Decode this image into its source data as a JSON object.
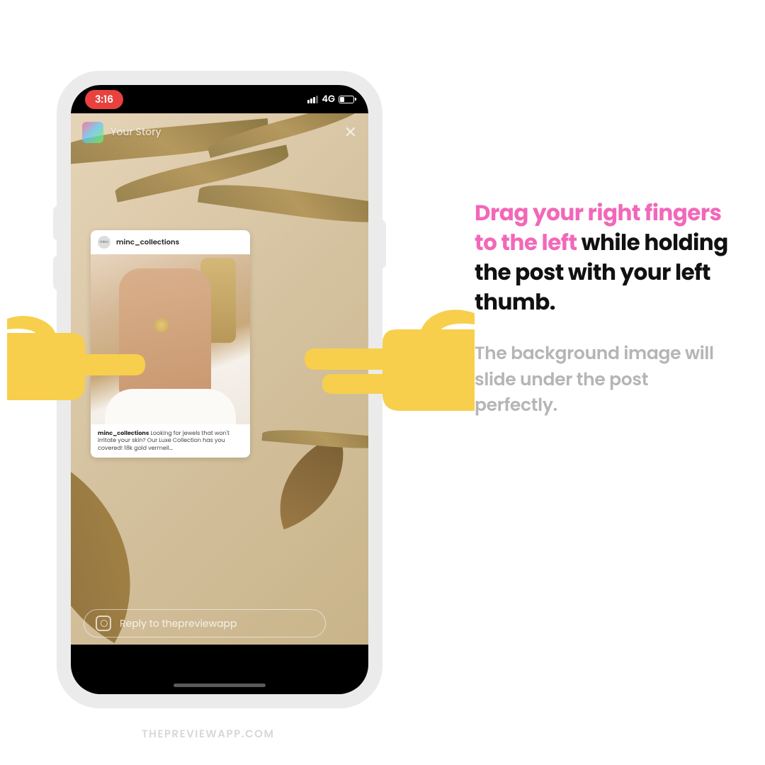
{
  "statusbar": {
    "time": "3:16",
    "network": "4G"
  },
  "story": {
    "title": "Your Story",
    "reply_placeholder": "Reply to thepreviewapp"
  },
  "post": {
    "avatar_text": "minc",
    "username": "minc_collections",
    "caption_user": "minc_collections",
    "caption_text": " Looking for jewels that won't irritate your skin? Our Luxe Collection has you covered! 18k gold vermeil..."
  },
  "instructions": {
    "highlight": "Drag your right fingers to the left",
    "rest": " while holding the post with your left thumb.",
    "subtext": "The background image will slide under the post perfectly."
  },
  "watermark": "THEPREVIEWAPP.COM"
}
